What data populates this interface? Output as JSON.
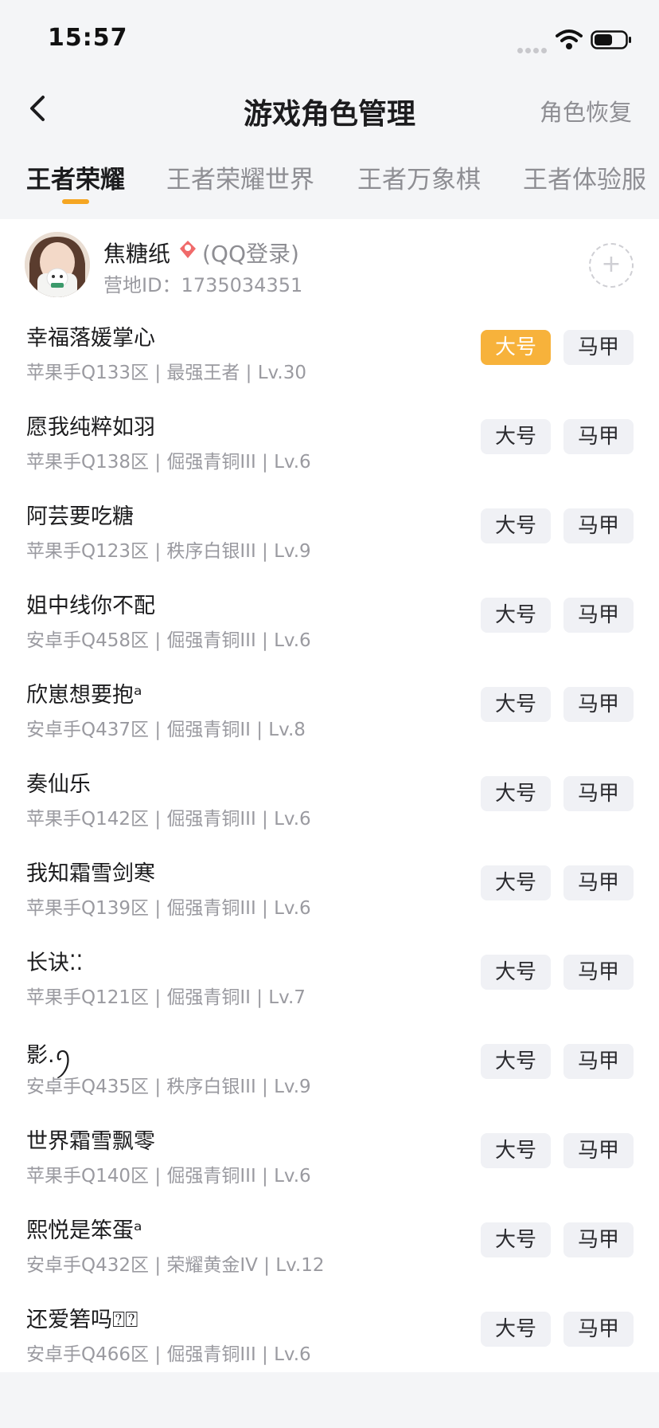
{
  "status_bar": {
    "time": "15:57"
  },
  "nav": {
    "title": "游戏角色管理",
    "action": "角色恢复"
  },
  "tabs": [
    {
      "label": "王者荣耀",
      "active": true
    },
    {
      "label": "王者荣耀世界",
      "active": false
    },
    {
      "label": "王者万象棋",
      "active": false
    },
    {
      "label": "王者体验服",
      "active": false
    }
  ],
  "account": {
    "name": "焦糖纸",
    "login_type": "(QQ登录)",
    "camp_id": "营地ID：1735034351",
    "add_icon": "+"
  },
  "buttons": {
    "main": "大号",
    "alt": "马甲"
  },
  "roles": [
    {
      "name": "幸福落媛掌心",
      "info": "苹果手Q133区 | 最强王者 | Lv.30",
      "main_selected": true
    },
    {
      "name": "愿我纯粹如羽",
      "info": "苹果手Q138区 | 倔强青铜III | Lv.6",
      "main_selected": false
    },
    {
      "name": "阿芸要吃糖",
      "info": "苹果手Q123区 | 秩序白银III | Lv.9",
      "main_selected": false
    },
    {
      "name": "姐中线你不配",
      "info": "安卓手Q458区 | 倔强青铜III | Lv.6",
      "main_selected": false
    },
    {
      "name": "欣崽想要抱ᵃ",
      "info": "安卓手Q437区 | 倔强青铜II | Lv.8",
      "main_selected": false
    },
    {
      "name": "奏仙乐",
      "info": "苹果手Q142区 | 倔强青铜III | Lv.6",
      "main_selected": false
    },
    {
      "name": "我知霜雪剑寒",
      "info": "苹果手Q139区 | 倔强青铜III | Lv.6",
      "main_selected": false
    },
    {
      "name": "长诀⁚⁚",
      "info": "苹果手Q121区 | 倔强青铜II | Lv.7",
      "main_selected": false
    },
    {
      "name": "影.ꪆ",
      "info": "安卓手Q435区 | 秩序白银III | Lv.9",
      "main_selected": false
    },
    {
      "name": "世界霜雪飘零",
      "info": "苹果手Q140区 | 倔强青铜III | Lv.6",
      "main_selected": false
    },
    {
      "name": "熙悦是笨蛋ᵃ",
      "info": "安卓手Q432区 | 荣耀黄金IV | Lv.12",
      "main_selected": false
    },
    {
      "name": "还爱箬吗⍰⍰",
      "info": "安卓手Q466区 | 倔强青铜III | Lv.6",
      "main_selected": false
    }
  ],
  "colors": {
    "accent": "#f7b23b",
    "indicator": "#f5a623",
    "pill_bg": "#f0f1f5"
  }
}
